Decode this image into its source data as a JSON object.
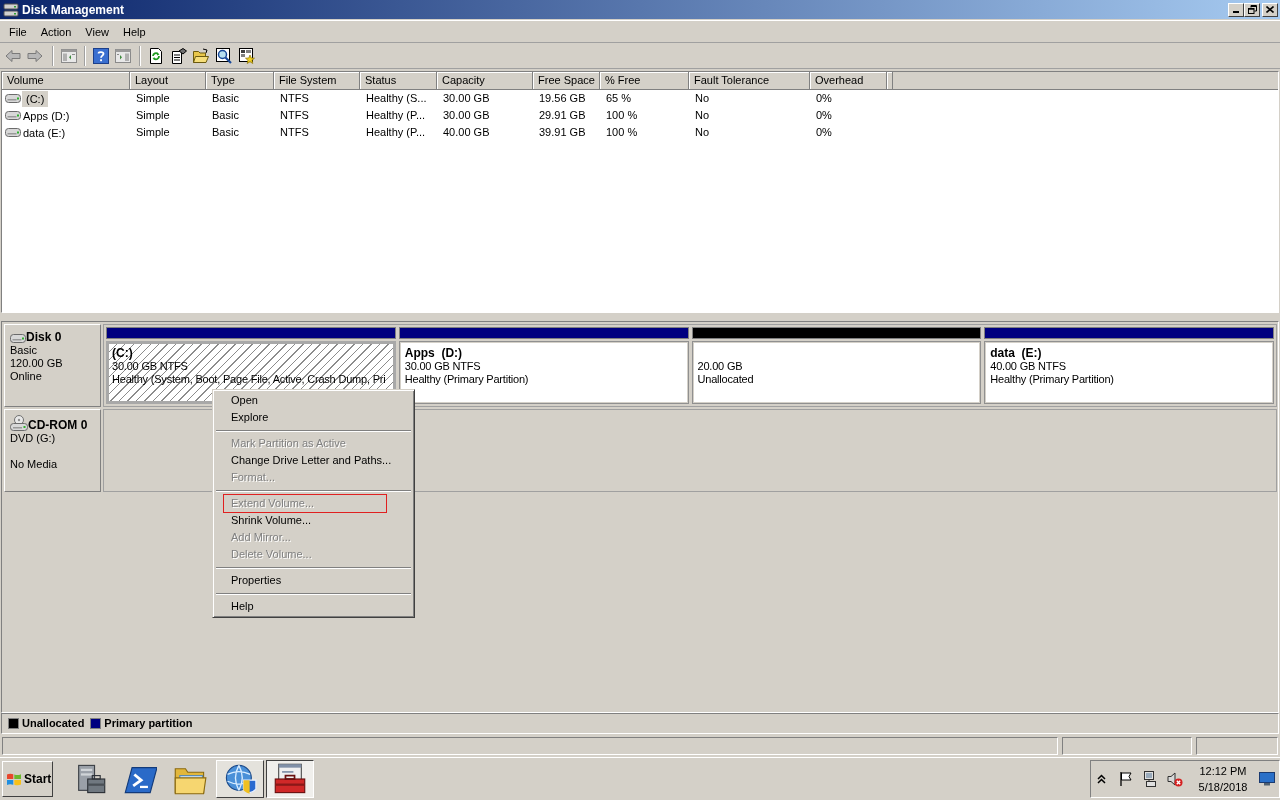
{
  "window": {
    "title": "Disk Management"
  },
  "menu_bar": [
    "File",
    "Action",
    "View",
    "Help"
  ],
  "volume_list": {
    "columns": [
      "Volume",
      "Layout",
      "Type",
      "File System",
      "Status",
      "Capacity",
      "Free Space",
      "% Free",
      "Fault Tolerance",
      "Overhead"
    ],
    "rows": [
      {
        "selected": true,
        "cells": [
          "(C:)",
          "Simple",
          "Basic",
          "NTFS",
          "Healthy (S...",
          "30.00 GB",
          "19.56 GB",
          "65 %",
          "No",
          "0%"
        ]
      },
      {
        "selected": false,
        "cells": [
          "Apps (D:)",
          "Simple",
          "Basic",
          "NTFS",
          "Healthy (P...",
          "30.00 GB",
          "29.91 GB",
          "100 %",
          "No",
          "0%"
        ]
      },
      {
        "selected": false,
        "cells": [
          "data (E:)",
          "Simple",
          "Basic",
          "NTFS",
          "Healthy (P...",
          "40.00 GB",
          "39.91 GB",
          "100 %",
          "No",
          "0%"
        ]
      }
    ]
  },
  "disks": [
    {
      "kind": "disk",
      "name": "Disk 0",
      "type": "Basic",
      "size": "120.00 GB",
      "status": "Online",
      "partitions": [
        {
          "label": "(C:)",
          "size": "30.00 GB NTFS",
          "status": "Healthy (System, Boot, Page File, Active, Crash Dump, Pri",
          "color": "#000080",
          "selected": true
        },
        {
          "label": "Apps  (D:)",
          "size": "30.00 GB NTFS",
          "status": "Healthy (Primary Partition)",
          "color": "#000080",
          "selected": false
        },
        {
          "size": "20.00 GB",
          "status": "Unallocated",
          "color": "#000000",
          "selected": false
        },
        {
          "label": "data  (E:)",
          "size": "40.00 GB NTFS",
          "status": "Healthy (Primary Partition)",
          "color": "#000080",
          "selected": false
        }
      ]
    },
    {
      "kind": "cdrom",
      "name": "CD-ROM 0",
      "type": "DVD (G:)",
      "status": "No Media"
    }
  ],
  "context_menu": {
    "items": [
      {
        "kind": "item",
        "label": "Open",
        "disabled": false,
        "outlined": false
      },
      {
        "kind": "item",
        "label": "Explore",
        "disabled": false,
        "outlined": false
      },
      {
        "kind": "separator"
      },
      {
        "kind": "item",
        "label": "Mark Partition as Active",
        "disabled": true,
        "outlined": false
      },
      {
        "kind": "item",
        "label": "Change Drive Letter and Paths...",
        "disabled": false,
        "outlined": false
      },
      {
        "kind": "item",
        "label": "Format...",
        "disabled": true,
        "outlined": false
      },
      {
        "kind": "separator"
      },
      {
        "kind": "item",
        "label": "Extend Volume...",
        "disabled": true,
        "outlined": true
      },
      {
        "kind": "item",
        "label": "Shrink Volume...",
        "disabled": false,
        "outlined": false
      },
      {
        "kind": "item",
        "label": "Add Mirror...",
        "disabled": true,
        "outlined": false
      },
      {
        "kind": "item",
        "label": "Delete Volume...",
        "disabled": true,
        "outlined": false
      },
      {
        "kind": "separator"
      },
      {
        "kind": "item",
        "label": "Properties",
        "disabled": false,
        "outlined": false
      },
      {
        "kind": "separator"
      },
      {
        "kind": "item",
        "label": "Help",
        "disabled": false,
        "outlined": false
      }
    ]
  },
  "legend": [
    {
      "label": "Unallocated",
      "color": "#000000"
    },
    {
      "label": "Primary partition",
      "color": "#000080"
    }
  ],
  "taskbar": {
    "start": "Start",
    "buttons": [
      {
        "kind": "server",
        "running": false,
        "selected": false
      },
      {
        "kind": "shell",
        "running": false,
        "selected": false
      },
      {
        "kind": "folder",
        "running": false,
        "selected": false
      },
      {
        "kind": "globe",
        "running": true,
        "selected": false
      },
      {
        "kind": "toolbox",
        "running": true,
        "selected": true
      }
    ],
    "clock": {
      "time": "12:12 PM",
      "date": "5/18/2018"
    }
  }
}
